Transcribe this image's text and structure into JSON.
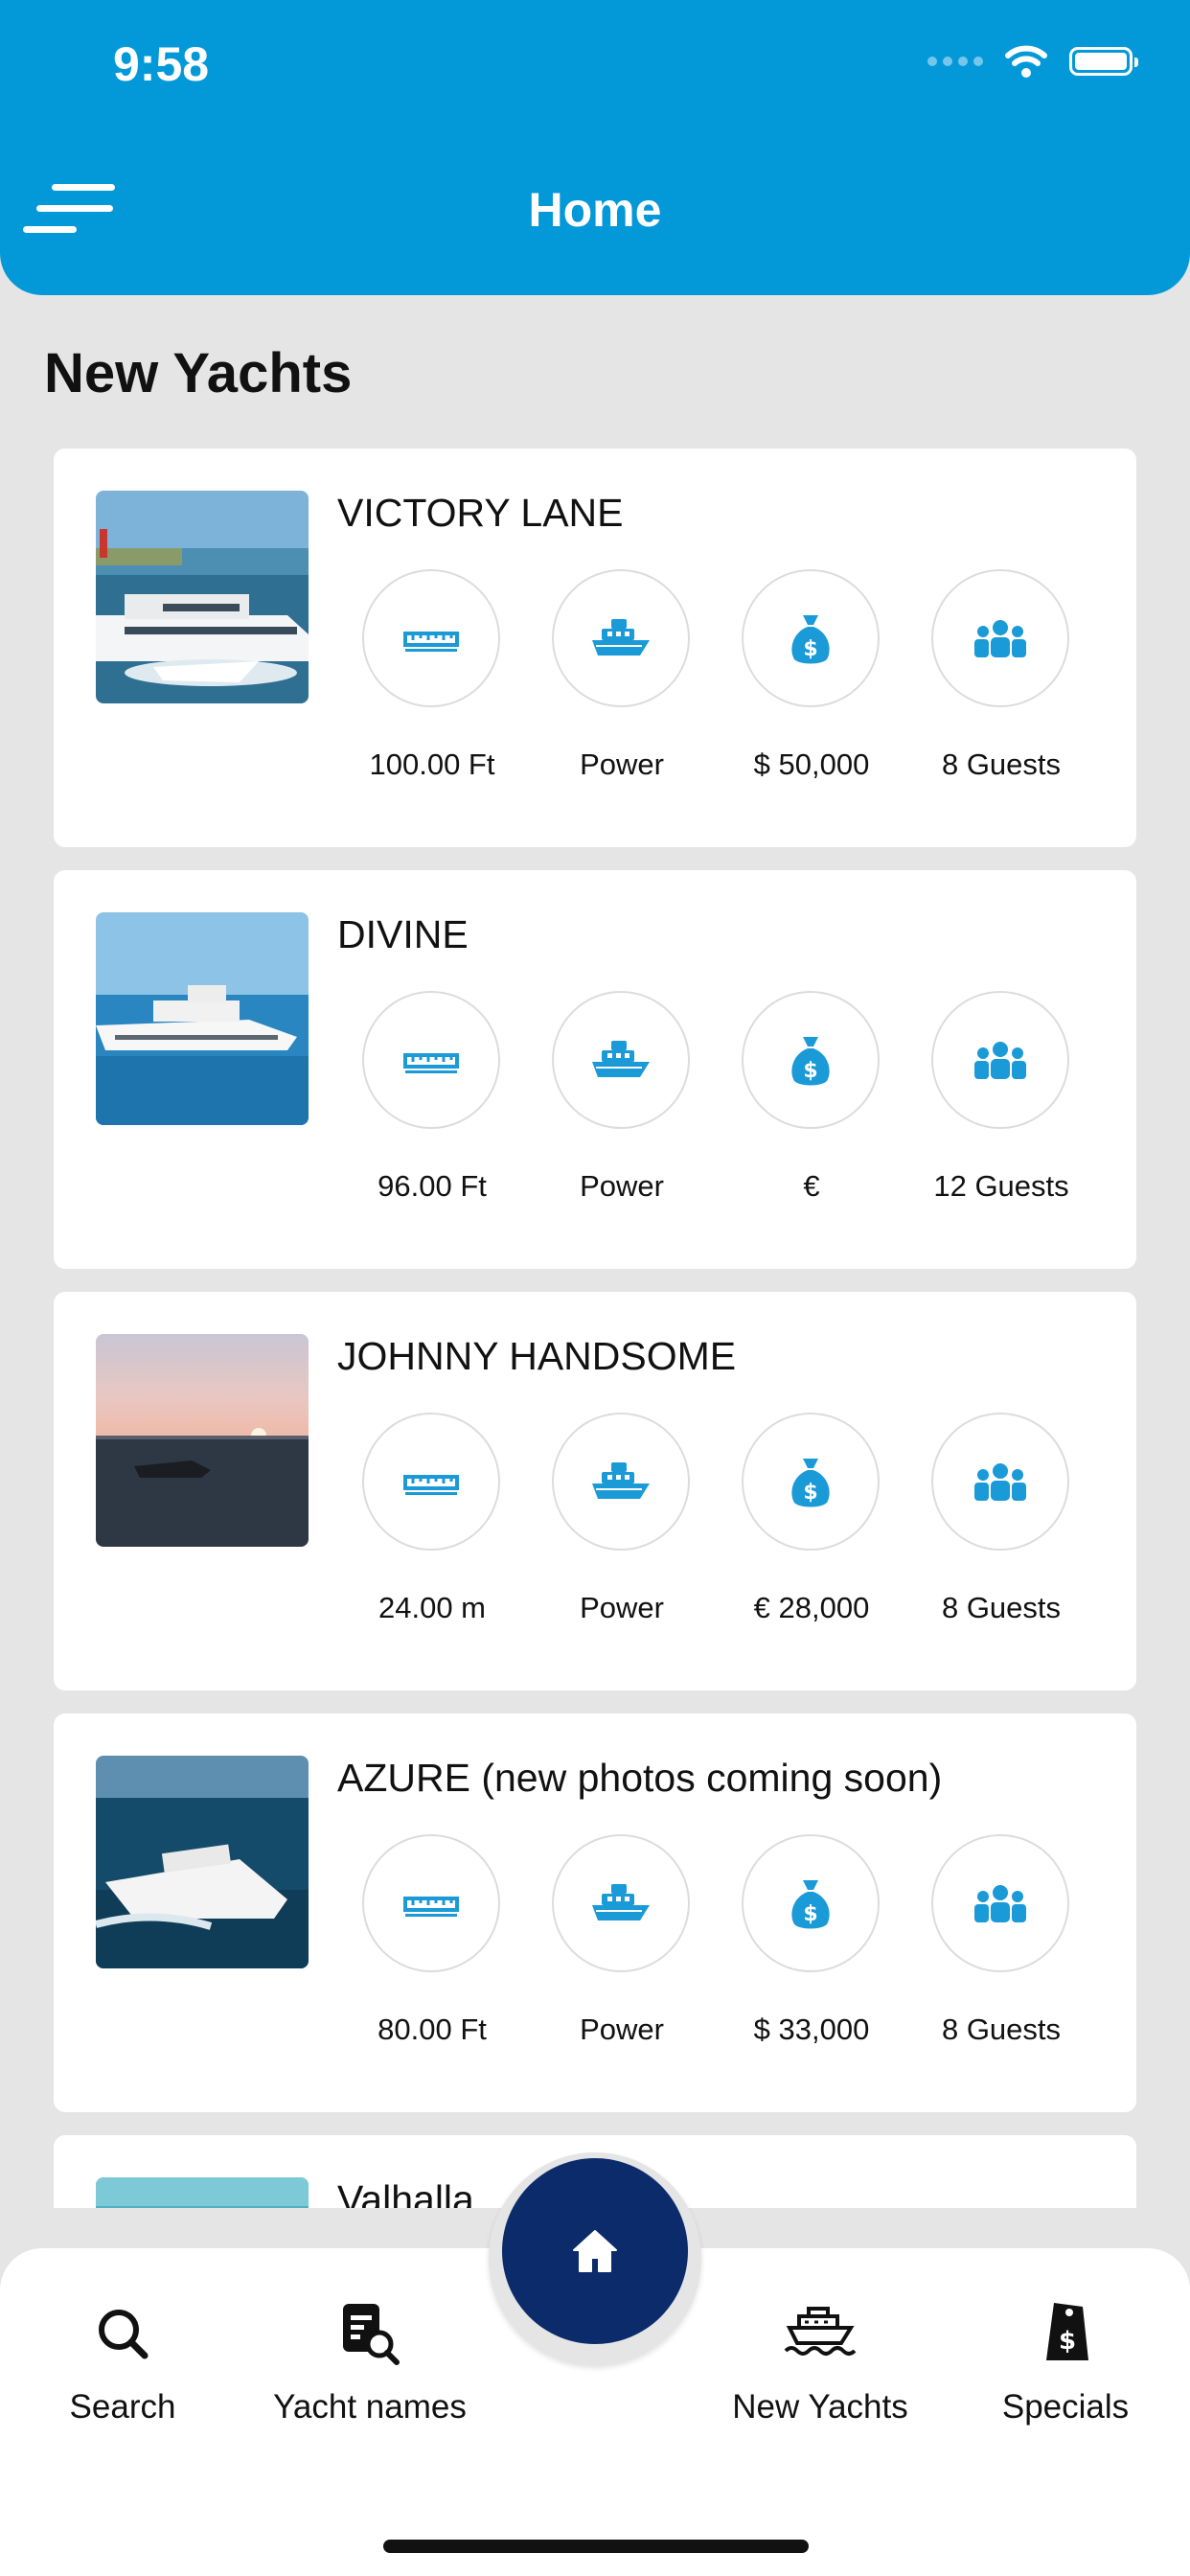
{
  "status_bar": {
    "time": "9:58"
  },
  "header": {
    "title": "Home",
    "menu_icon": "menu-icon"
  },
  "section": {
    "title": "New Yachts"
  },
  "colors": {
    "header": "#0399d9",
    "accent_icon": "#1a9ad6",
    "home_button": "#0c2b6b"
  },
  "yachts": [
    {
      "name": "VICTORY LANE",
      "length": "100.00 Ft",
      "type": "Power",
      "price": "$ 50,000",
      "guests": "8 Guests"
    },
    {
      "name": "DIVINE",
      "length": "96.00 Ft",
      "type": "Power",
      "price": "€",
      "guests": "12 Guests"
    },
    {
      "name": "JOHNNY HANDSOME",
      "length": "24.00 m",
      "type": "Power",
      "price": "€ 28,000",
      "guests": "8 Guests"
    },
    {
      "name": "AZURE (new photos coming soon)",
      "length": "80.00 Ft",
      "type": "Power",
      "price": "$ 33,000",
      "guests": "8 Guests"
    },
    {
      "name": "Valhalla"
    }
  ],
  "bottom_nav": {
    "items": [
      {
        "label": "Search",
        "icon": "search-icon"
      },
      {
        "label": "Yacht names",
        "icon": "document-search-icon"
      },
      {
        "label": "New Yachts",
        "icon": "ship-icon"
      },
      {
        "label": "Specials",
        "icon": "price-tag-icon"
      }
    ],
    "center_icon": "home-icon"
  }
}
